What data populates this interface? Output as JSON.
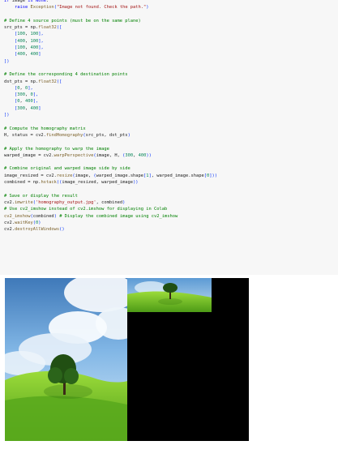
{
  "notebook": {
    "code_lines": [
      [
        {
          "t": "if ",
          "c": "kw"
        },
        {
          "t": "image ",
          "c": "var"
        },
        {
          "t": "is None",
          "c": "kw"
        },
        {
          "t": ":",
          "c": "var"
        }
      ],
      [
        {
          "t": "    ",
          "c": "var"
        },
        {
          "t": "raise ",
          "c": "kw"
        },
        {
          "t": "Exception",
          "c": "fn"
        },
        {
          "t": "(",
          "c": "br"
        },
        {
          "t": "\"Image not found. Check the path.\"",
          "c": "str"
        },
        {
          "t": ")",
          "c": "br"
        }
      ],
      [],
      [
        {
          "t": "# Define 4 source points (must be on the same plane)",
          "c": "com"
        }
      ],
      [
        {
          "t": "src_pts = np.",
          "c": "var"
        },
        {
          "t": "float32",
          "c": "fn"
        },
        {
          "t": "([",
          "c": "br"
        }
      ],
      [
        {
          "t": "    [",
          "c": "br"
        },
        {
          "t": "100",
          "c": "num"
        },
        {
          "t": ", ",
          "c": "var"
        },
        {
          "t": "100",
          "c": "num"
        },
        {
          "t": "],",
          "c": "br"
        }
      ],
      [
        {
          "t": "    [",
          "c": "br"
        },
        {
          "t": "400",
          "c": "num"
        },
        {
          "t": ", ",
          "c": "var"
        },
        {
          "t": "100",
          "c": "num"
        },
        {
          "t": "],",
          "c": "br"
        }
      ],
      [
        {
          "t": "    [",
          "c": "br"
        },
        {
          "t": "100",
          "c": "num"
        },
        {
          "t": ", ",
          "c": "var"
        },
        {
          "t": "400",
          "c": "num"
        },
        {
          "t": "],",
          "c": "br"
        }
      ],
      [
        {
          "t": "    [",
          "c": "br"
        },
        {
          "t": "400",
          "c": "num"
        },
        {
          "t": ", ",
          "c": "var"
        },
        {
          "t": "400",
          "c": "num"
        },
        {
          "t": "]",
          "c": "br"
        }
      ],
      [
        {
          "t": "])",
          "c": "br"
        }
      ],
      [],
      [
        {
          "t": "# Define the corresponding 4 destination points",
          "c": "com"
        }
      ],
      [
        {
          "t": "dst_pts = np.",
          "c": "var"
        },
        {
          "t": "float32",
          "c": "fn"
        },
        {
          "t": "([",
          "c": "br"
        }
      ],
      [
        {
          "t": "    [",
          "c": "br"
        },
        {
          "t": "0",
          "c": "num"
        },
        {
          "t": ", ",
          "c": "var"
        },
        {
          "t": "0",
          "c": "num"
        },
        {
          "t": "],",
          "c": "br"
        }
      ],
      [
        {
          "t": "    [",
          "c": "br"
        },
        {
          "t": "300",
          "c": "num"
        },
        {
          "t": ", ",
          "c": "var"
        },
        {
          "t": "0",
          "c": "num"
        },
        {
          "t": "],",
          "c": "br"
        }
      ],
      [
        {
          "t": "    [",
          "c": "br"
        },
        {
          "t": "0",
          "c": "num"
        },
        {
          "t": ", ",
          "c": "var"
        },
        {
          "t": "400",
          "c": "num"
        },
        {
          "t": "],",
          "c": "br"
        }
      ],
      [
        {
          "t": "    [",
          "c": "br"
        },
        {
          "t": "300",
          "c": "num"
        },
        {
          "t": ", ",
          "c": "var"
        },
        {
          "t": "400",
          "c": "num"
        },
        {
          "t": "]",
          "c": "br"
        }
      ],
      [
        {
          "t": "])",
          "c": "br"
        }
      ],
      [],
      [
        {
          "t": "# Compute the homography matrix",
          "c": "com"
        }
      ],
      [
        {
          "t": "H, status = cv2.",
          "c": "var"
        },
        {
          "t": "findHomography",
          "c": "fn"
        },
        {
          "t": "(",
          "c": "br"
        },
        {
          "t": "src_pts, dst_pts",
          "c": "var"
        },
        {
          "t": ")",
          "c": "br"
        }
      ],
      [],
      [
        {
          "t": "# Apply the homography to warp the image",
          "c": "com"
        }
      ],
      [
        {
          "t": "warped_image = cv2.",
          "c": "var"
        },
        {
          "t": "warpPerspective",
          "c": "fn"
        },
        {
          "t": "(",
          "c": "br"
        },
        {
          "t": "image, H, ",
          "c": "var"
        },
        {
          "t": "(",
          "c": "br"
        },
        {
          "t": "300",
          "c": "num"
        },
        {
          "t": ", ",
          "c": "var"
        },
        {
          "t": "400",
          "c": "num"
        },
        {
          "t": "))",
          "c": "br"
        }
      ],
      [],
      [
        {
          "t": "# Combine original and warped image side by side",
          "c": "com"
        }
      ],
      [
        {
          "t": "image_resized = cv2.",
          "c": "var"
        },
        {
          "t": "resize",
          "c": "fn"
        },
        {
          "t": "(",
          "c": "br"
        },
        {
          "t": "image, ",
          "c": "var"
        },
        {
          "t": "(",
          "c": "br"
        },
        {
          "t": "warped_image.shape",
          "c": "var"
        },
        {
          "t": "[",
          "c": "br"
        },
        {
          "t": "1",
          "c": "num"
        },
        {
          "t": "]",
          "c": "br"
        },
        {
          "t": ", warped_image.shape",
          "c": "var"
        },
        {
          "t": "[",
          "c": "br"
        },
        {
          "t": "0",
          "c": "num"
        },
        {
          "t": "]))",
          "c": "br"
        }
      ],
      [
        {
          "t": "combined = np.",
          "c": "var"
        },
        {
          "t": "hstack",
          "c": "fn"
        },
        {
          "t": "((",
          "c": "br"
        },
        {
          "t": "image_resized, warped_image",
          "c": "var"
        },
        {
          "t": "))",
          "c": "br"
        }
      ],
      [],
      [
        {
          "t": "# Save or display the result",
          "c": "com"
        }
      ],
      [
        {
          "t": "cv2.",
          "c": "var"
        },
        {
          "t": "imwrite",
          "c": "fn"
        },
        {
          "t": "(",
          "c": "br"
        },
        {
          "t": "'homography_output.jpg'",
          "c": "str"
        },
        {
          "t": ", combined",
          "c": "var"
        },
        {
          "t": ")",
          "c": "br"
        }
      ],
      [
        {
          "t": "# Use cv2_imshow instead of cv2.imshow for displaying in Colab",
          "c": "com"
        }
      ],
      [
        {
          "t": "cv2_imshow",
          "c": "fn"
        },
        {
          "t": "(",
          "c": "br"
        },
        {
          "t": "combined",
          "c": "var"
        },
        {
          "t": ") ",
          "c": "br"
        },
        {
          "t": "# Display the combined image using cv2_imshow",
          "c": "com"
        }
      ],
      [
        {
          "t": "cv2.",
          "c": "var"
        },
        {
          "t": "waitKey",
          "c": "fn"
        },
        {
          "t": "(",
          "c": "br"
        },
        {
          "t": "0",
          "c": "num"
        },
        {
          "t": ")",
          "c": "br"
        }
      ],
      [
        {
          "t": "cv2.",
          "c": "var"
        },
        {
          "t": "destroyAllWindows",
          "c": "fn"
        },
        {
          "t": "()",
          "c": "br"
        }
      ]
    ]
  },
  "output": {
    "image_content": "landscape-with-tree",
    "colors": {
      "sky": "#5b93c8",
      "cloud": "#f4f7fb",
      "grass": "#76c02c",
      "dark_grass": "#3f8a14",
      "black": "#000000"
    }
  }
}
